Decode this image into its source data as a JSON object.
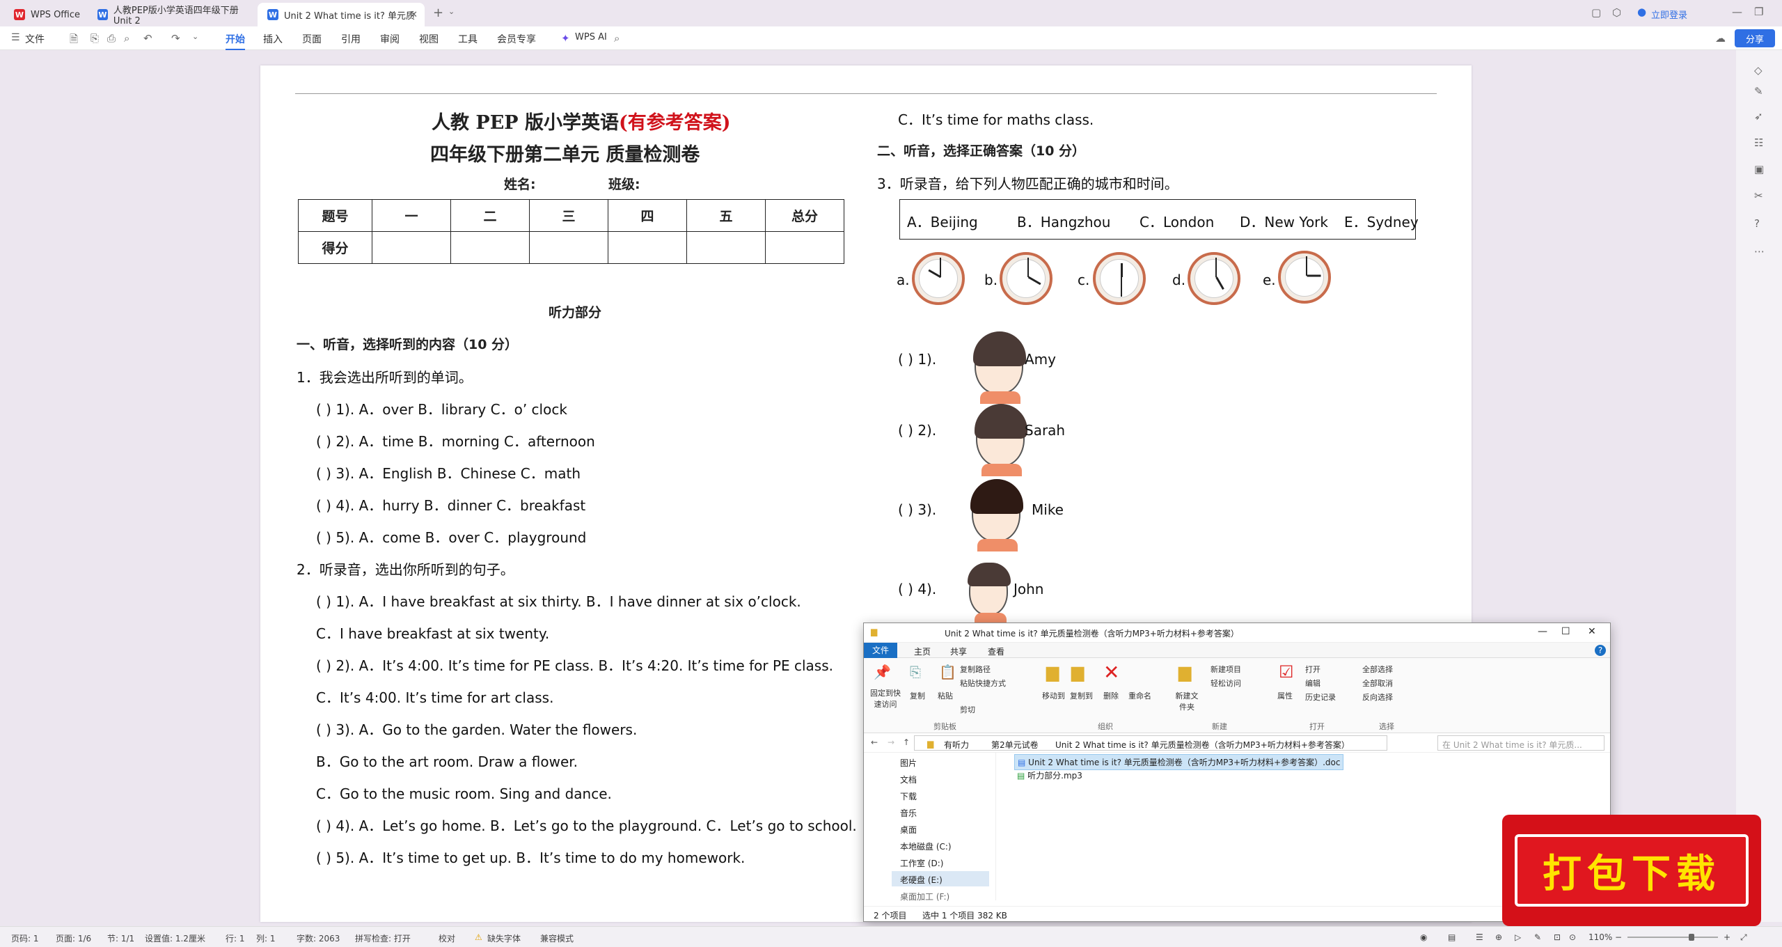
{
  "tabs": [
    {
      "label": "WPS Office",
      "icon": "wps-logo"
    },
    {
      "label": "人教PEP版小学英语四年级下册Unit 2",
      "icon": "word-doc-icon"
    },
    {
      "label": "Unit 2 What time is it? 单元质",
      "icon": "word-doc-icon"
    }
  ],
  "title_bar": {
    "login": "立即登录"
  },
  "menu": {
    "file": "文件",
    "items": [
      "开始",
      "插入",
      "页面",
      "引用",
      "审阅",
      "视图",
      "工具",
      "会员专享"
    ],
    "wps_ai": "WPS AI",
    "share": "分享"
  },
  "doc": {
    "title1": "人教 PEP 版小学英语",
    "title1_red": "(有参考答案)",
    "title2": "四年级下册第二单元 质量检测卷",
    "name_label": "姓名:",
    "class_label": "班级:",
    "score_table": {
      "headers": [
        "题号",
        "一",
        "二",
        "三",
        "四",
        "五",
        "总分"
      ],
      "row2": "得分"
    },
    "listening": "听力部分",
    "sec1": "一、听音，选择听到的内容（10 分）",
    "q1": "1．我会选出所听到的单词。",
    "q1_items": [
      "(          ) 1). A．over      B．library      C．o’ clock",
      "(          ) 2). A．time      B．morning      C．afternoon",
      "(          ) 3). A．English      B．Chinese      C．math",
      "(          ) 4). A．hurry      B．dinner      C．breakfast",
      "(          ) 5). A．come      B．over      C．playground"
    ],
    "q2": "2．听录音，选出你所听到的句子。",
    "q2_items": [
      "(       ) 1). A．I have breakfast at six thirty.    B．I have dinner at six o’clock.",
      "C．I have breakfast at six twenty.",
      "(       ) 2). A．It’s 4:00. It’s time for PE class.   B．It’s 4:20. It’s time for PE class.",
      "C．It’s 4:00. It’s time for art class.",
      "(       ) 3). A．Go to the garden. Water the flowers.",
      "B．Go to the art room. Draw a flower.",
      "C．Go to the music room. Sing and dance.",
      "(       ) 4). A．Let’s go home.   B．Let’s go to the playground.   C．Let’s go to school.",
      "(       ) 5). A．It’s time to get up.   B．It’s time to do my homework."
    ],
    "r_c": "C．It’s time for maths class.",
    "sec2": "二、听音，选择正确答案（10 分）",
    "q3": "3．听录音，给下列人物匹配正确的城市和时间。",
    "cities": [
      "A．Beijing",
      "B．Hangzhou",
      "C．London",
      "D．New York",
      "E．Sydney"
    ],
    "clocks": [
      "a.",
      "b.",
      "c.",
      "d.",
      "e."
    ],
    "people": [
      {
        "num": "(        ) 1).",
        "name": "Amy"
      },
      {
        "num": "(        ) 2).",
        "name": "Sarah"
      },
      {
        "num": "(        ) 3).",
        "name": "Mike"
      },
      {
        "num": "(        ) 4).",
        "name": "John"
      }
    ]
  },
  "explorer": {
    "title": "Unit 2 What time is it? 单元质量检测卷（含听力MP3+听力材料+参考答案）",
    "ribbon_tabs": [
      "文件",
      "主页",
      "共享",
      "查看"
    ],
    "groups": [
      "剪贴板",
      "组织",
      "新建",
      "打开",
      "选择"
    ],
    "buttons": {
      "pin": "固定到快速访问",
      "copy": "复制",
      "paste": "粘贴",
      "copy_path": "复制路径",
      "paste_shortcut": "粘贴快捷方式",
      "cut": "剪切",
      "move_to": "移动到",
      "copy_to": "复制到",
      "delete": "删除",
      "rename": "重命名",
      "new_folder": "新建文件夹",
      "new_item": "新建项目",
      "easy_access": "轻松访问",
      "properties": "属性",
      "open": "打开",
      "edit": "编辑",
      "history": "历史记录",
      "select_all": "全部选择",
      "select_none": "全部取消",
      "invert": "反向选择"
    },
    "path": [
      "有听力",
      "第2单元试卷",
      "Unit 2 What time is it? 单元质量检测卷（含听力MP3+听力材料+参考答案）"
    ],
    "search_placeholder": "在 Unit 2 What time is it? 单元质...",
    "nav": [
      "图片",
      "文档",
      "下载",
      "音乐",
      "桌面",
      "本地磁盘 (C:)",
      "工作室 (D:)",
      "老硬盘 (E:)",
      "桌面加工 (F:)"
    ],
    "files": [
      "Unit 2 What time is it? 单元质量检测卷（含听力MP3+听力材料+参考答案）.doc",
      "听力部分.mp3"
    ],
    "status": {
      "count": "2 个项目",
      "selected": "选中 1 个项目  382 KB"
    }
  },
  "badge": "打包下载",
  "status": {
    "page": "页码: 1",
    "pages": "页面: 1/6",
    "section": "节: 1/1",
    "setting": "设置值: 1.2厘米",
    "row": "行: 1",
    "col": "列: 1",
    "words": "字数: 2063",
    "spell": "拼写检查: 打开",
    "proof": "校对",
    "font": "缺失字体",
    "compat": "兼容模式",
    "zoom": "110%"
  }
}
